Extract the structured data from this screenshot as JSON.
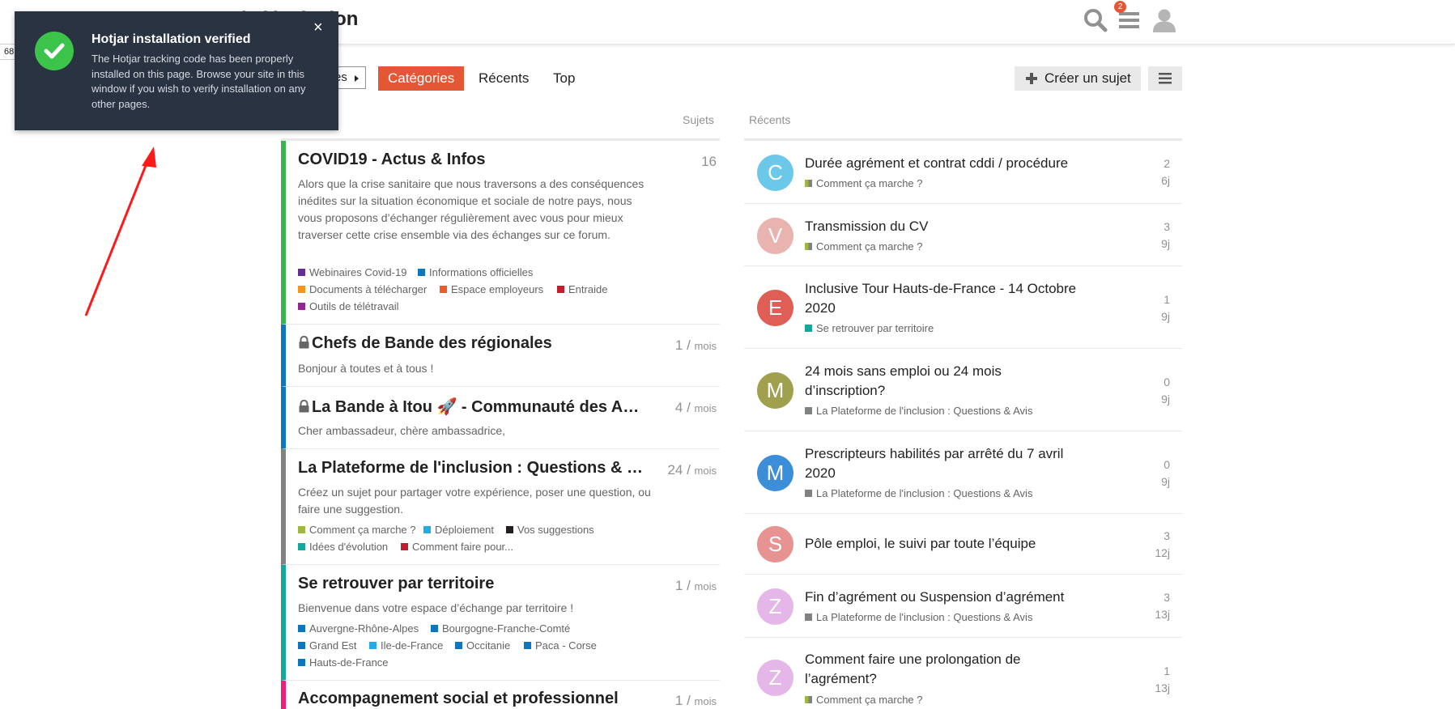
{
  "header": {
    "site_title": "de l'inclusion",
    "notification_count": "2",
    "side_number": "68"
  },
  "nav": {
    "breadcrumb_label": "es",
    "tabs": [
      "Catégories",
      "Récents",
      "Top"
    ],
    "active_tab": "Catégories",
    "create_label": "Créer un sujet"
  },
  "columns": {
    "topics_head": "Sujets",
    "recent_head": "Récents"
  },
  "categories": [
    {
      "title": "COVID19 - Actus & Infos",
      "count": "16",
      "unit": "",
      "locked": false,
      "color": "#3ab54a",
      "description": "Alors que la crise sanitaire que nous traversons a des conséquences inédites sur la situation économique et sociale de notre pays, nous vous proposons d’échanger régulièrement avec vous pour mieux traverser cette crise ensemble via des échanges sur ce forum.",
      "subcategories": [
        {
          "name": "Webinaires Covid-19",
          "color": "#652d90"
        },
        {
          "name": "Informations officielles",
          "color": "#0e76bd"
        },
        {
          "name": "Documents à télécharger",
          "color": "#f7941d"
        },
        {
          "name": "Espace employeurs",
          "color": "#f1592a"
        },
        {
          "name": "Entraide",
          "color": "#be1e2d"
        },
        {
          "name": "Outils de télétravail",
          "color": "#92278f"
        }
      ]
    },
    {
      "title": "Chefs de Bande des régionales",
      "count": "1",
      "unit": "mois",
      "locked": true,
      "color": "#0e76bd",
      "description": "Bonjour à toutes et à tous !",
      "subcategories": []
    },
    {
      "title": "La Bande à Itou 🚀 - Communauté des A…",
      "count": "4",
      "unit": "mois",
      "locked": true,
      "color": "#0e76bd",
      "description": "Cher ambassadeur, chère ambassadrice,",
      "subcategories": []
    },
    {
      "title": "La Plateforme de l'inclusion : Questions & …",
      "count": "24",
      "unit": "mois",
      "locked": false,
      "color": "#808281",
      "description": "Créez un sujet pour partager votre expérience, poser une question, ou faire une suggestion.",
      "subcategories": [
        {
          "name": "Comment ça marche ?",
          "color": "#9eb83b"
        },
        {
          "name": "Déploiement",
          "color": "#25aae1"
        },
        {
          "name": "Vos suggestions",
          "color": "#231f20"
        },
        {
          "name": "Idées d'évolution",
          "color": "#12a89d"
        },
        {
          "name": "Comment faire pour...",
          "color": "#be1e2d"
        }
      ]
    },
    {
      "title": "Se retrouver par territoire",
      "count": "1",
      "unit": "mois",
      "locked": false,
      "color": "#12a89d",
      "description": "Bienvenue dans votre espace d’échange par territoire !",
      "subcategories": [
        {
          "name": "Auvergne-Rhône-Alpes",
          "color": "#0e76bd"
        },
        {
          "name": "Bourgogne-Franche-Comté",
          "color": "#0e76bd"
        },
        {
          "name": "Grand Est",
          "color": "#0e76bd"
        },
        {
          "name": "Ile-de-France",
          "color": "#25aae1"
        },
        {
          "name": "Occitanie",
          "color": "#0e76bd"
        },
        {
          "name": "Paca - Corse",
          "color": "#0e76bd"
        },
        {
          "name": "Hauts-de-France",
          "color": "#0e76bd"
        }
      ]
    },
    {
      "title": "Accompagnement social et professionnel",
      "count": "1",
      "unit": "mois",
      "locked": false,
      "color": "#ed207b",
      "description": "",
      "subcategories": []
    }
  ],
  "topics": [
    {
      "title": "Durée agrément et contrat cddi / procédure",
      "category": "Comment ça marche ?",
      "cat_color": "#9eb83b",
      "posts": "2",
      "age": "6j",
      "letter": "C",
      "avatar_color": "#6cc8e8"
    },
    {
      "title": "Transmission du CV",
      "category": "Comment ça marche ?",
      "cat_color": "#9eb83b",
      "posts": "3",
      "age": "9j",
      "letter": "V",
      "avatar_color": "#e9b3b0"
    },
    {
      "title": "Inclusive Tour Hauts-de-France - 14 Octobre 2020",
      "category": "Se retrouver par territoire",
      "cat_color": "#12a89d",
      "posts": "1",
      "age": "9j",
      "letter": "E",
      "avatar_color": "#df5f56"
    },
    {
      "title": "24 mois sans emploi ou 24 mois d’inscription?",
      "category": "La Plateforme de l'inclusion : Questions & Avis",
      "cat_color": "#808281",
      "posts": "0",
      "age": "9j",
      "letter": "M",
      "avatar_color": "#a0a04f"
    },
    {
      "title": "Prescripteurs habilités par arrêté du 7 avril 2020",
      "category": "La Plateforme de l'inclusion : Questions & Avis",
      "cat_color": "#808281",
      "posts": "0",
      "age": "9j",
      "letter": "M",
      "avatar_color": "#3d8ed8"
    },
    {
      "title": "Pôle emploi, le suivi par toute l’équipe",
      "category": "",
      "cat_color": "",
      "posts": "3",
      "age": "12j",
      "letter": "S",
      "avatar_color": "#e69392"
    },
    {
      "title": "Fin d’agrément ou Suspension d’agrément",
      "category": "La Plateforme de l'inclusion : Questions & Avis",
      "cat_color": "#808281",
      "posts": "3",
      "age": "13j",
      "letter": "Z",
      "avatar_color": "#e5b7e8"
    },
    {
      "title": "Comment faire une prolongation de l’agrément?",
      "category": "Comment ça marche ?",
      "cat_color": "#9eb83b",
      "posts": "1",
      "age": "13j",
      "letter": "Z",
      "avatar_color": "#e5b7e8"
    }
  ],
  "toast": {
    "title": "Hotjar installation verified",
    "body": "The Hotjar tracking code has been properly installed on this page. Browse your site in this window if you wish to verify installation on any other pages.",
    "close": "×"
  }
}
